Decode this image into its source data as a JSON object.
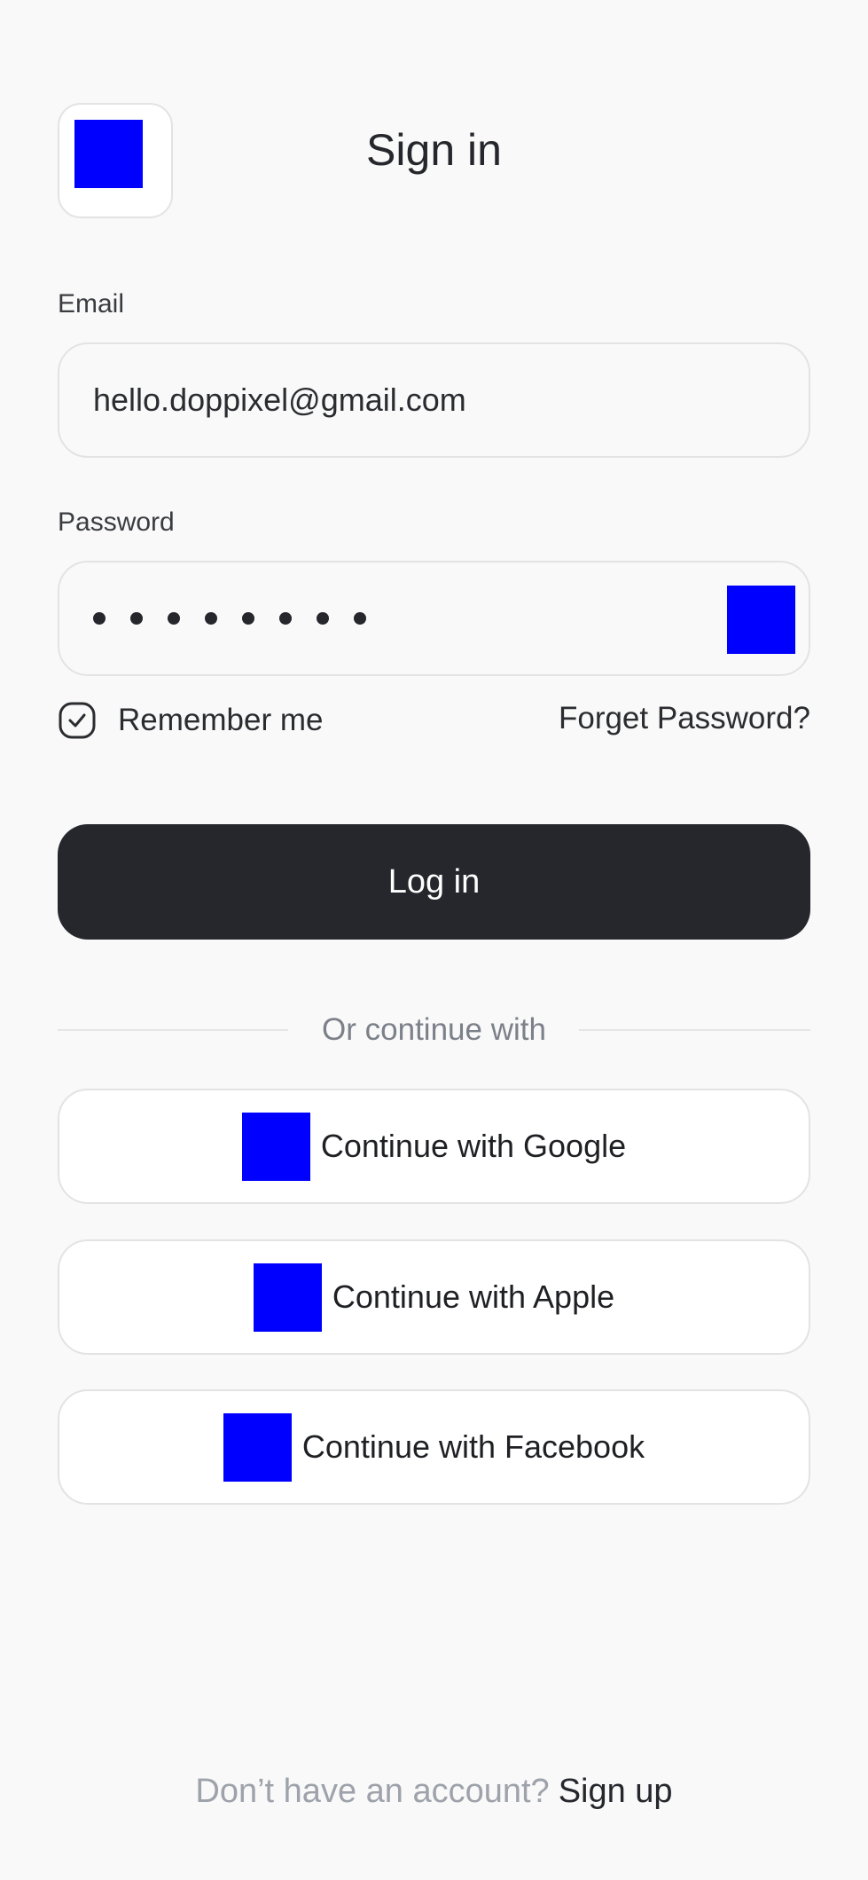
{
  "header": {
    "back_icon": "back-icon",
    "title": "Sign in"
  },
  "form": {
    "email_label": "Email",
    "email_value": "hello.doppixel@gmail.com",
    "password_label": "Password",
    "password_mask_length": 8,
    "password_toggle_icon": "eye-icon",
    "remember_label": "Remember me",
    "remember_checked": true,
    "forgot_label": "Forget Password?",
    "login_label": "Log in"
  },
  "social": {
    "divider_label": "Or continue with",
    "google_label": "Continue with Google",
    "apple_label": "Continue with Apple",
    "facebook_label": "Continue with Facebook"
  },
  "footer": {
    "prompt": "Don’t have an account?",
    "signup_label": "Sign up"
  },
  "colors": {
    "background": "#f9f9f9",
    "primary_button": "#25272c",
    "placeholder_icon": "#0000ff"
  }
}
